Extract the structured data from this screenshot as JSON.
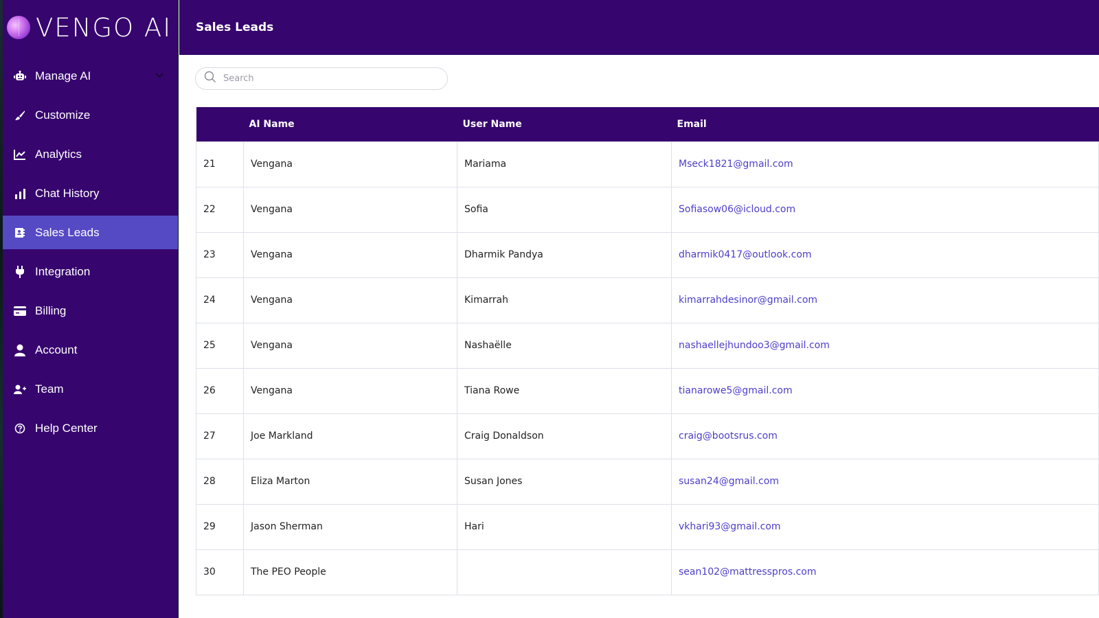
{
  "app": {
    "brand_name": "VENGO AI",
    "brand_color": "#36056e",
    "active_color": "#5649c4",
    "link_color": "#4b3ec9"
  },
  "header": {
    "title": "Sales Leads"
  },
  "sidebar": {
    "items": [
      {
        "label": "Manage AI",
        "icon": "robot-icon",
        "has_chevron": true,
        "active": false
      },
      {
        "label": "Customize",
        "icon": "brush-icon",
        "active": false
      },
      {
        "label": "Analytics",
        "icon": "line-chart-icon",
        "active": false
      },
      {
        "label": "Chat History",
        "icon": "bar-chart-icon",
        "active": false
      },
      {
        "label": "Sales Leads",
        "icon": "contact-card-icon",
        "active": true
      },
      {
        "label": "Integration",
        "icon": "plug-icon",
        "active": false
      },
      {
        "label": "Billing",
        "icon": "credit-card-icon",
        "active": false
      },
      {
        "label": "Account",
        "icon": "user-icon",
        "active": false
      },
      {
        "label": "Team",
        "icon": "user-plus-icon",
        "active": false
      },
      {
        "label": "Help Center",
        "icon": "help-circle-icon",
        "active": false
      }
    ]
  },
  "search": {
    "placeholder": "Search",
    "value": ""
  },
  "table": {
    "columns": [
      "",
      "AI Name",
      "User Name",
      "Email"
    ],
    "rows": [
      {
        "id": "21",
        "ai_name": "Vengana",
        "user_name": "Mariama",
        "email": "Mseck1821@gmail.com"
      },
      {
        "id": "22",
        "ai_name": "Vengana",
        "user_name": "Sofia",
        "email": "Sofiasow06@icloud.com"
      },
      {
        "id": "23",
        "ai_name": "Vengana",
        "user_name": "Dharmik Pandya",
        "email": "dharmik0417@outlook.com"
      },
      {
        "id": "24",
        "ai_name": "Vengana",
        "user_name": "Kimarrah",
        "email": "kimarrahdesinor@gmail.com"
      },
      {
        "id": "25",
        "ai_name": "Vengana",
        "user_name": "Nashaëlle",
        "email": "nashaellejhundoo3@gmail.com"
      },
      {
        "id": "26",
        "ai_name": "Vengana",
        "user_name": "Tiana Rowe",
        "email": "tianarowe5@gmail.com"
      },
      {
        "id": "27",
        "ai_name": "Joe Markland",
        "user_name": "Craig Donaldson",
        "email": "craig@bootsrus.com"
      },
      {
        "id": "28",
        "ai_name": "Eliza Marton",
        "user_name": "Susan Jones",
        "email": "susan24@gmail.com"
      },
      {
        "id": "29",
        "ai_name": "Jason Sherman",
        "user_name": "Hari",
        "email": "vkhari93@gmail.com"
      },
      {
        "id": "30",
        "ai_name": "The PEO People",
        "user_name": "",
        "email": "sean102@mattresspros.com"
      }
    ]
  }
}
